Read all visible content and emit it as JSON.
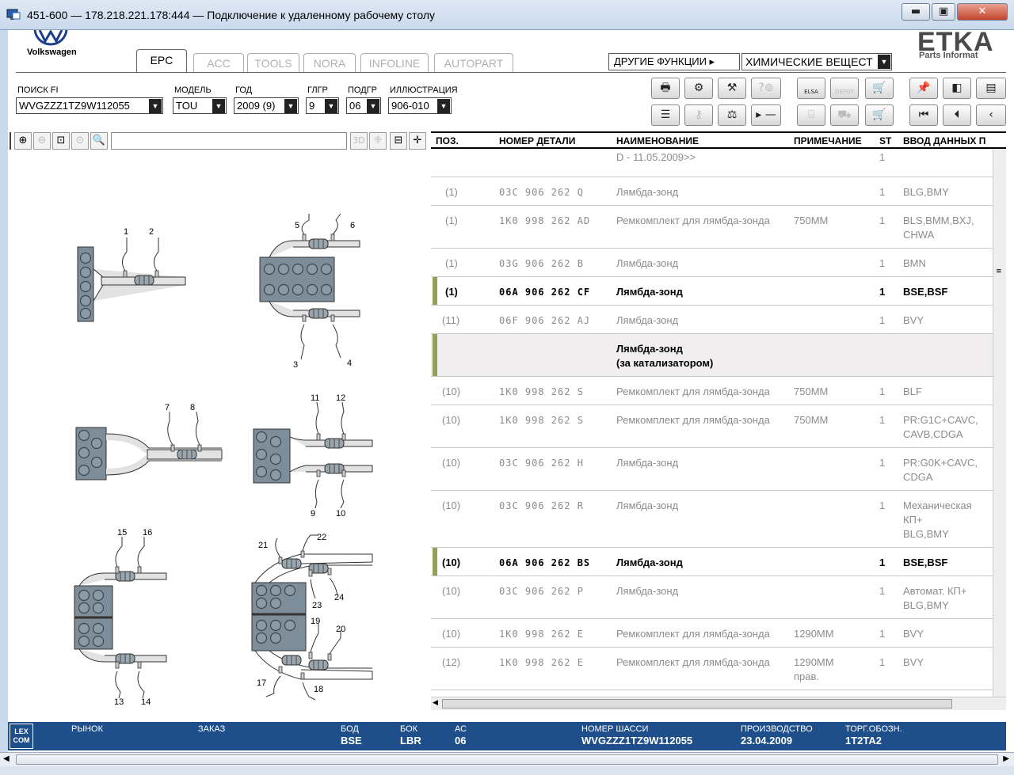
{
  "window": {
    "title": "451-600 — 178.218.221.178:444 — Подключение к удаленному рабочему столу",
    "minimize": "▬",
    "restore": "▣",
    "close": "✕"
  },
  "brand": {
    "vw_text": "Volkswagen",
    "etka": "ETKA",
    "etka_sub": "Parts Informat"
  },
  "tabs": [
    {
      "label": "EPC"
    },
    {
      "label": "ACC"
    },
    {
      "label": "TOOLS"
    },
    {
      "label": "NORA"
    },
    {
      "label": "INFOLINE"
    },
    {
      "label": "AUTOPART"
    }
  ],
  "other_functions": {
    "label": "ДРУГИЕ ФУНКЦИИ ▸",
    "value": "ХИМИЧЕСКИЕ ВЕЩЕСТ"
  },
  "filters": [
    {
      "label": "ПОИСК FI",
      "value": "WVGZZZ1TZ9W112055"
    },
    {
      "label": "МОДЕЛЬ",
      "value": "TOU"
    },
    {
      "label": "ГОД",
      "value": "2009 (9)"
    },
    {
      "label": "ГЛГР",
      "value": "9"
    },
    {
      "label": "ПОДГР",
      "value": "06"
    },
    {
      "label": "ИЛЛЮСТРАЦИЯ",
      "value": "906-010"
    }
  ],
  "toolbar": {
    "elsa": "ELSA",
    "depot": "DEPOT"
  },
  "zoom": {
    "btn_3d": "3D"
  },
  "table": {
    "headers": [
      "ПОЗ.",
      "НОМЕР ДЕТАЛИ",
      "НАИМЕНОВАНИЕ",
      "ПРИМЕЧАНИЕ",
      "ST",
      "ВВОД ДАННЫХ П"
    ],
    "rows": [
      {
        "pos": "",
        "part": "",
        "name": "D - 11.05.2009>>",
        "note": "",
        "st": "1",
        "data": ""
      },
      {
        "pos": "(1)",
        "part": "03C 906 262 Q",
        "name": "Лямбда-зонд",
        "note": "",
        "st": "1",
        "data": "BLG,BMY"
      },
      {
        "pos": "(1)",
        "part": "1K0 998 262 AD",
        "name": "Ремкомплект для лямбда-зонда",
        "note": "750MM",
        "st": "1",
        "data": "BLS,BMM,BXJ,",
        "data2": "CHWA"
      },
      {
        "pos": "(1)",
        "part": "03G 906 262 B",
        "name": "Лямбда-зонд",
        "note": "",
        "st": "1",
        "data": "BMN"
      },
      {
        "pos": "(1)",
        "part": "06A 906 262 CF",
        "name": "Лямбда-зонд",
        "note": "",
        "st": "1",
        "data": "BSE,BSF"
      },
      {
        "pos": "(11)",
        "part": "06F 906 262 AJ",
        "name": "Лямбда-зонд",
        "note": "",
        "st": "1",
        "data": "BVY"
      },
      {
        "pos": "",
        "part": "",
        "name": "Лямбда-зонд",
        "name2": "(за катализатором)",
        "note": "",
        "st": "",
        "data": ""
      },
      {
        "pos": "(10)",
        "part": "1K0 998 262 S",
        "name": "Ремкомплект для лямбда-зонда",
        "note": "750MM",
        "st": "1",
        "data": "BLF"
      },
      {
        "pos": "(10)",
        "part": "1K0 998 262 S",
        "name": "Ремкомплект для лямбда-зонда",
        "note": "750MM",
        "st": "1",
        "data": "PR:G1C+CAVC,",
        "data2": "CAVB,CDGA"
      },
      {
        "pos": "(10)",
        "part": "03C 906 262 H",
        "name": "Лямбда-зонд",
        "note": "",
        "st": "1",
        "data": "PR:G0K+CAVC,",
        "data2": "CDGA"
      },
      {
        "pos": "(10)",
        "part": "03C 906 262 R",
        "name": "Лямбда-зонд",
        "note": "",
        "st": "1",
        "data": "Механическая",
        "data2": "КП+",
        "data3": "BLG,BMY"
      },
      {
        "pos": "(10)",
        "part": "06A 906 262 BS",
        "name": "Лямбда-зонд",
        "note": "",
        "st": "1",
        "data": "BSE,BSF"
      },
      {
        "pos": "(10)",
        "part": "03C 906 262 P",
        "name": "Лямбда-зонд",
        "note": "",
        "st": "1",
        "data": "Автомат. КП+",
        "data2": "BLG,BMY"
      },
      {
        "pos": "(10)",
        "part": "1K0 998 262 E",
        "name": "Ремкомплект для лямбда-зонда",
        "note": "1290MM",
        "st": "1",
        "data": "BVY"
      },
      {
        "pos": "(12)",
        "part": "1K0 998 262 E",
        "name": "Ремкомплект для лямбда-зонда",
        "note": "1290MM",
        "note2": "прав.",
        "st": "1",
        "data": "BVY"
      }
    ]
  },
  "status": {
    "logo": "LEX COM",
    "fields": [
      {
        "label": "РЫНОК",
        "value": ""
      },
      {
        "label": "ЗАКАЗ",
        "value": ""
      },
      {
        "label": "БОД",
        "value": "BSE"
      },
      {
        "label": "БОК",
        "value": "LBR"
      },
      {
        "label": "АС",
        "value": "06"
      },
      {
        "label": "НОМЕР ШАССИ",
        "value": "WVGZZZ1TZ9W112055"
      },
      {
        "label": "ПРОИЗВОДСТВО",
        "value": "23.04.2009"
      },
      {
        "label": "ТОРГ.ОБОЗН.",
        "value": "1T2TA2"
      }
    ]
  },
  "illustration": {
    "labels": [
      "1",
      "2",
      "3",
      "4",
      "5",
      "6",
      "7",
      "8",
      "9",
      "10",
      "11",
      "12",
      "13",
      "14",
      "15",
      "16",
      "17",
      "18",
      "19",
      "20",
      "21",
      "22",
      "23",
      "24"
    ]
  },
  "colors": {
    "status_bar": "#1e4f8a",
    "row_marker": "#93a157",
    "engine_block": "#7d8d99"
  }
}
